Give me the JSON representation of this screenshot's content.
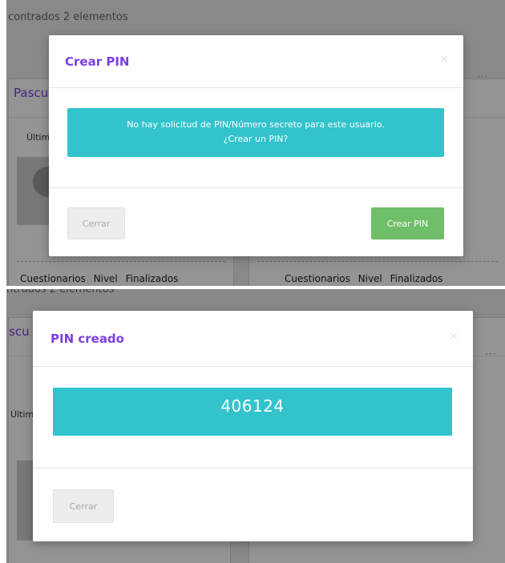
{
  "background": {
    "results_text": "contrados 2 elementos",
    "results_text_bottom": "ntrados 2 elementos",
    "card_title": "Pascu",
    "card_title_bottom": "scu",
    "last_label": "Últim",
    "dots": "···",
    "footer_stats": "Cuestionarios Nivel Finalizados"
  },
  "create_modal": {
    "title": "Crear PIN",
    "close_icon": "×",
    "message_line1": "No hay solicitud de PIN/Número secreto para este usuario.",
    "message_line2": "¿Crear un PIN?",
    "close_label": "Cerrar",
    "create_label": "Crear PIN"
  },
  "created_modal": {
    "title": "PIN creado",
    "close_icon": "×",
    "pin": "406124",
    "close_label": "Cerrar"
  },
  "colors": {
    "accent": "#7b3fe4",
    "info": "#33c3cc",
    "success": "#6fbe6a"
  }
}
